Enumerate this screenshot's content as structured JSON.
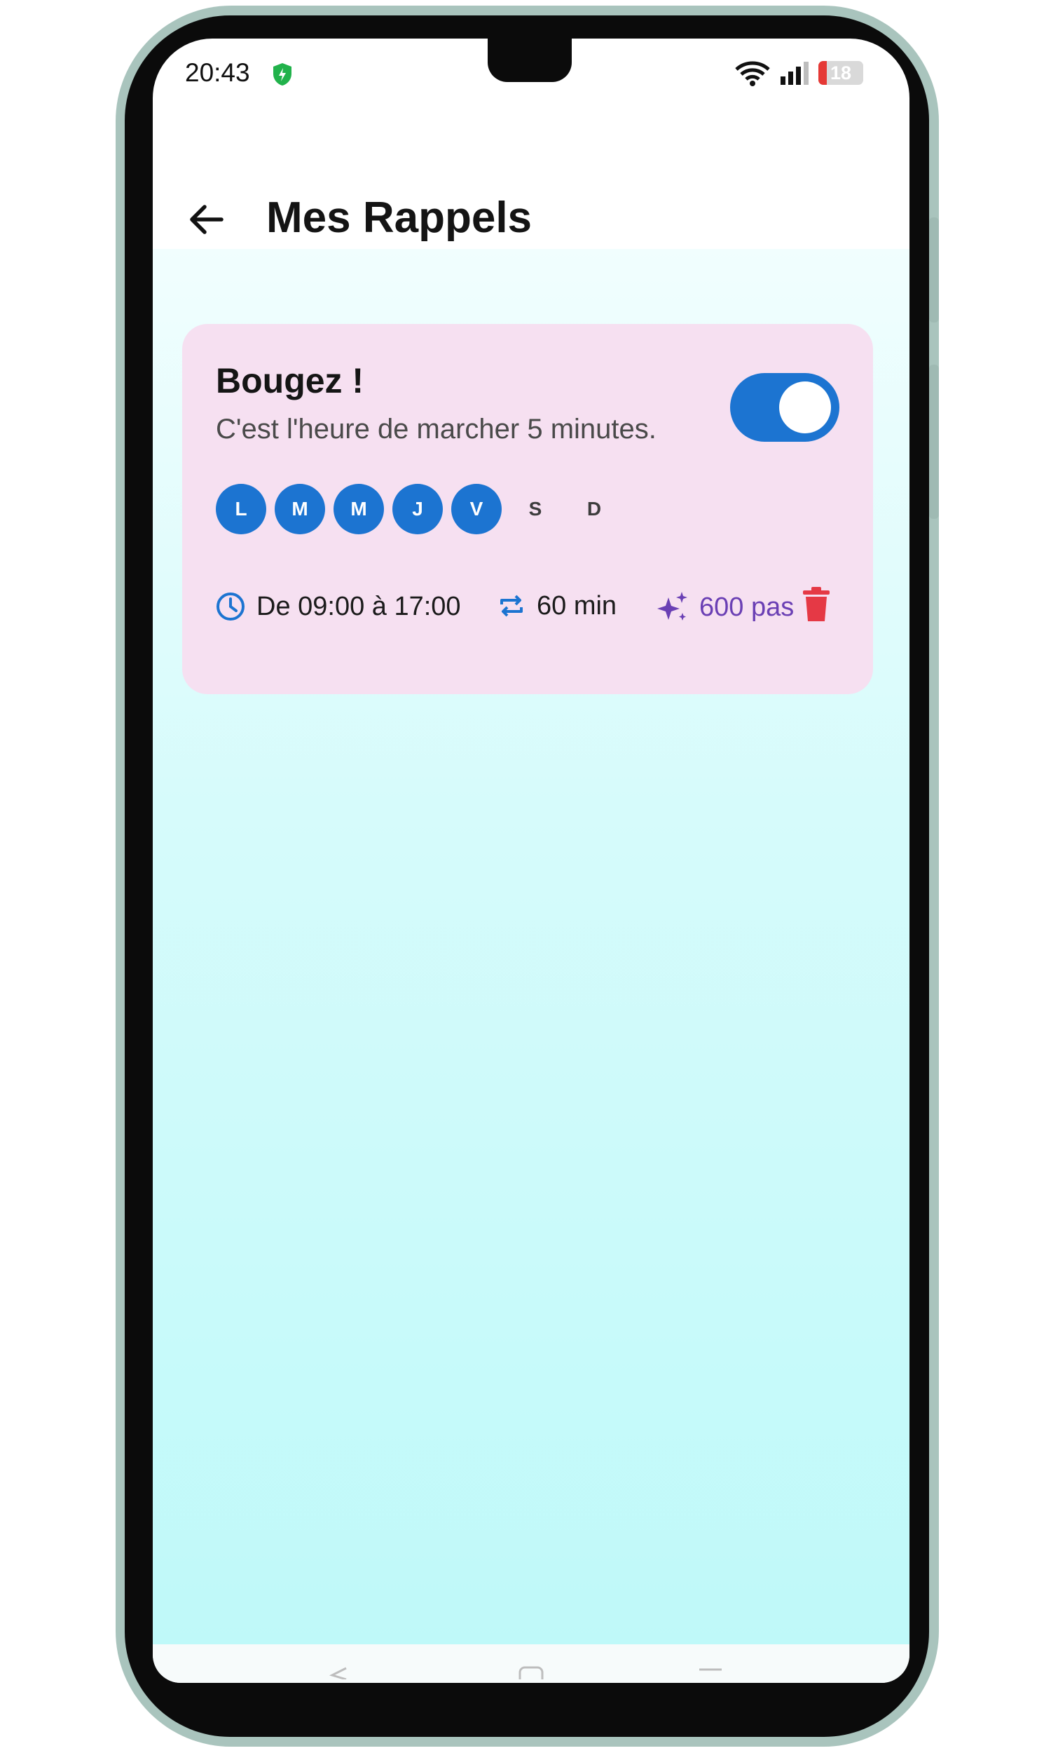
{
  "status_bar": {
    "time": "20:43",
    "battery_level": "18"
  },
  "app_bar": {
    "title": "Mes Rappels"
  },
  "reminder": {
    "title": "Bougez !",
    "message": "C'est l'heure de marcher 5 minutes.",
    "enabled": true,
    "days": [
      {
        "label": "L",
        "active": true
      },
      {
        "label": "M",
        "active": true
      },
      {
        "label": "M",
        "active": true
      },
      {
        "label": "J",
        "active": true
      },
      {
        "label": "V",
        "active": true
      },
      {
        "label": "S",
        "active": false
      },
      {
        "label": "D",
        "active": false
      }
    ],
    "time_range": "De 09:00 à 17:00",
    "interval": "60 min",
    "steps": "600 pas"
  },
  "colors": {
    "accent_blue": "#1c74d1",
    "card_bg": "#f6e0f1",
    "steps_purple": "#6a3fb4",
    "delete_red": "#e53945",
    "fab_bg": "#ead8f8"
  },
  "icons": {
    "back": "arrow-left-icon",
    "time": "clock-icon",
    "interval": "repeat-icon",
    "steps": "sparkle-icon",
    "delete": "trash-icon",
    "fab": "plus-icon"
  }
}
